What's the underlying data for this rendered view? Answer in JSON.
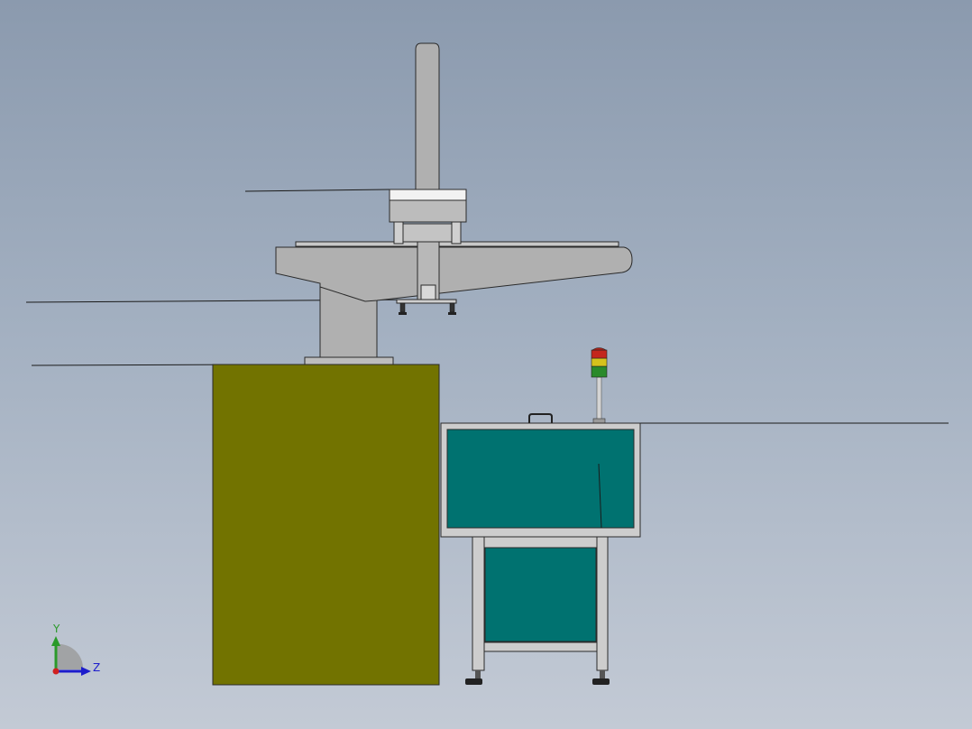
{
  "viewport": {
    "background_top": "#8b9aae",
    "background_bottom": "#c3cad5"
  },
  "model": {
    "colors": {
      "cabinet": "#727300",
      "panel": "#007270",
      "frame": "#cdcdcd",
      "arm": "#b0b0b0",
      "edge": "#2a2a2a"
    },
    "signal_tower": {
      "lights": [
        "#c4261c",
        "#d6c21c",
        "#2a8a2a"
      ]
    }
  },
  "triad": {
    "y_label": "Y",
    "z_label": "Z",
    "y_color": "#2a9a2a",
    "z_color": "#1c1ccc",
    "origin_color": "#d02020"
  }
}
